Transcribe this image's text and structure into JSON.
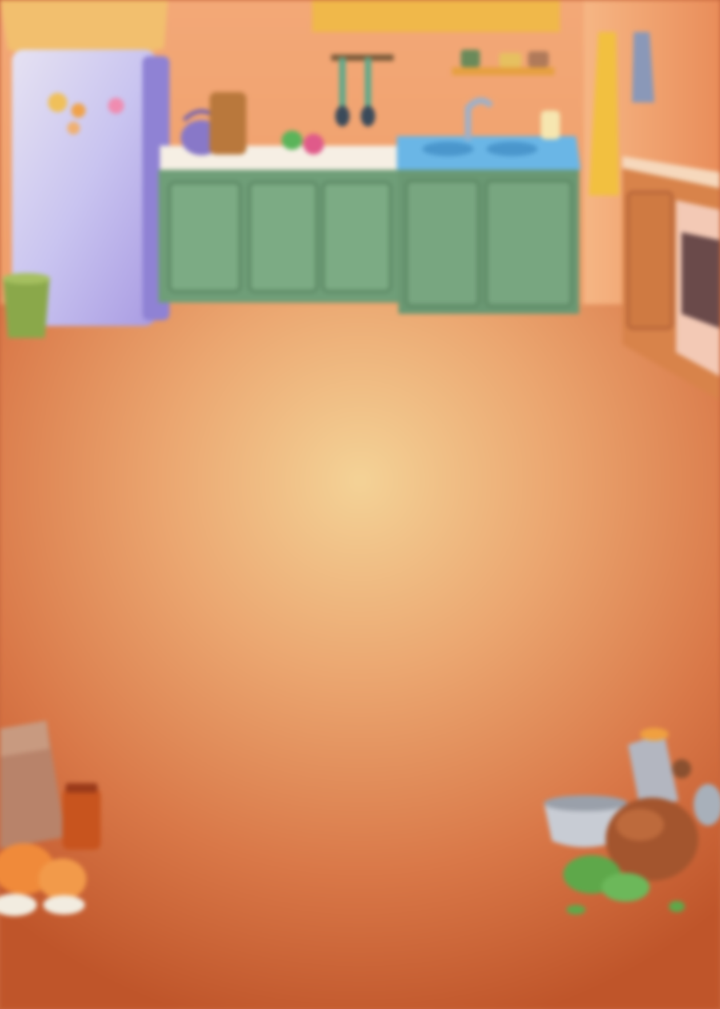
{
  "scene": {
    "type": "kitchen-background",
    "state": "blurred",
    "palette": {
      "wall": "#f0a06e",
      "floor_light": "#f4d095",
      "floor_dark": "#c15a2e",
      "cabinets": "#6f9e78",
      "sink": "#6ab6e6",
      "fridge": "#c8c4ee",
      "shelf": "#f0b84a"
    },
    "objects": [
      "curtain",
      "fridge",
      "fridge-magnets",
      "wastebasket",
      "kettle",
      "teapot",
      "counter",
      "vegetables",
      "utensil-rack",
      "spatula",
      "ladle",
      "sink",
      "faucet",
      "soap-bottle",
      "lower-cabinets",
      "wall-shelf",
      "spice-jars",
      "top-cabinet",
      "broom",
      "hanging-towel",
      "side-counter",
      "oven",
      "floor",
      "grocery-bag",
      "jam-jar",
      "oranges",
      "meat-grinder",
      "mixing-bowl",
      "roast-meat",
      "herbs"
    ]
  }
}
